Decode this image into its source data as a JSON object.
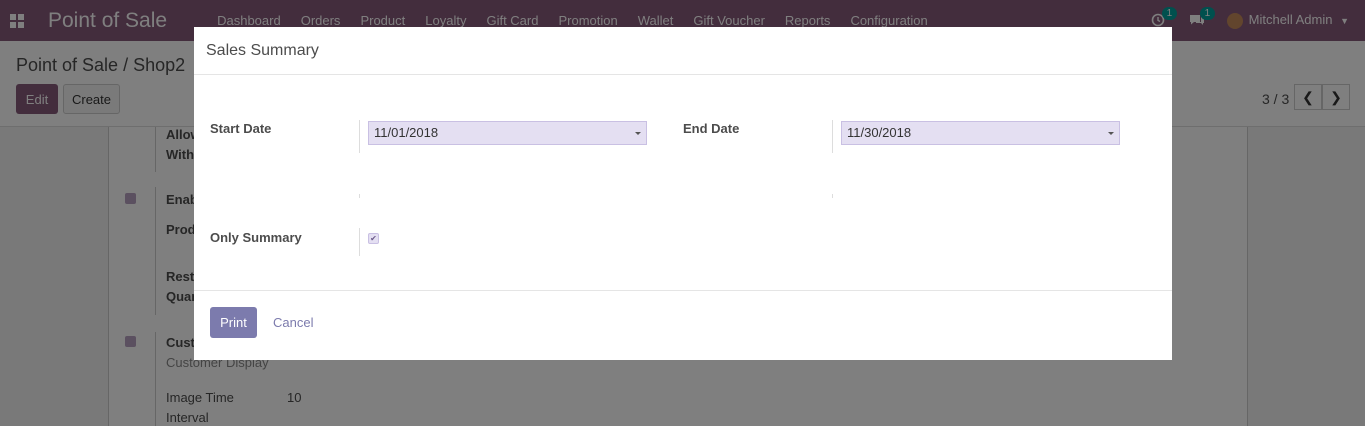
{
  "navbar": {
    "brand": "Point of Sale",
    "menu": [
      "Dashboard",
      "Orders",
      "Product",
      "Loyalty",
      "Gift Card",
      "Promotion",
      "Wallet",
      "Gift Voucher",
      "Reports",
      "Configuration"
    ],
    "activity_badge": "1",
    "messages_badge": "1",
    "user": "Mitchell Admin"
  },
  "control_panel": {
    "breadcrumb": "Point of Sale / Shop2",
    "edit_label": "Edit",
    "create_label": "Create",
    "pager": "3 / 3"
  },
  "background_form": {
    "allow_line1": "Allow",
    "allow_line2": "With",
    "enab": "Enab",
    "prod": "Prod",
    "restr": "Restr",
    "quan": "Quan",
    "cust": "Cust",
    "customer_display": "Customer Display",
    "image_time_label1": "Image Time",
    "image_time_label2": "Interval",
    "image_time_value": "10"
  },
  "modal": {
    "title": "Sales Summary",
    "start_date_label": "Start Date",
    "start_date_value": "11/01/2018",
    "end_date_label": "End Date",
    "end_date_value": "11/30/2018",
    "only_summary_label": "Only Summary",
    "only_summary_checked": true,
    "print_label": "Print",
    "cancel_label": "Cancel"
  }
}
